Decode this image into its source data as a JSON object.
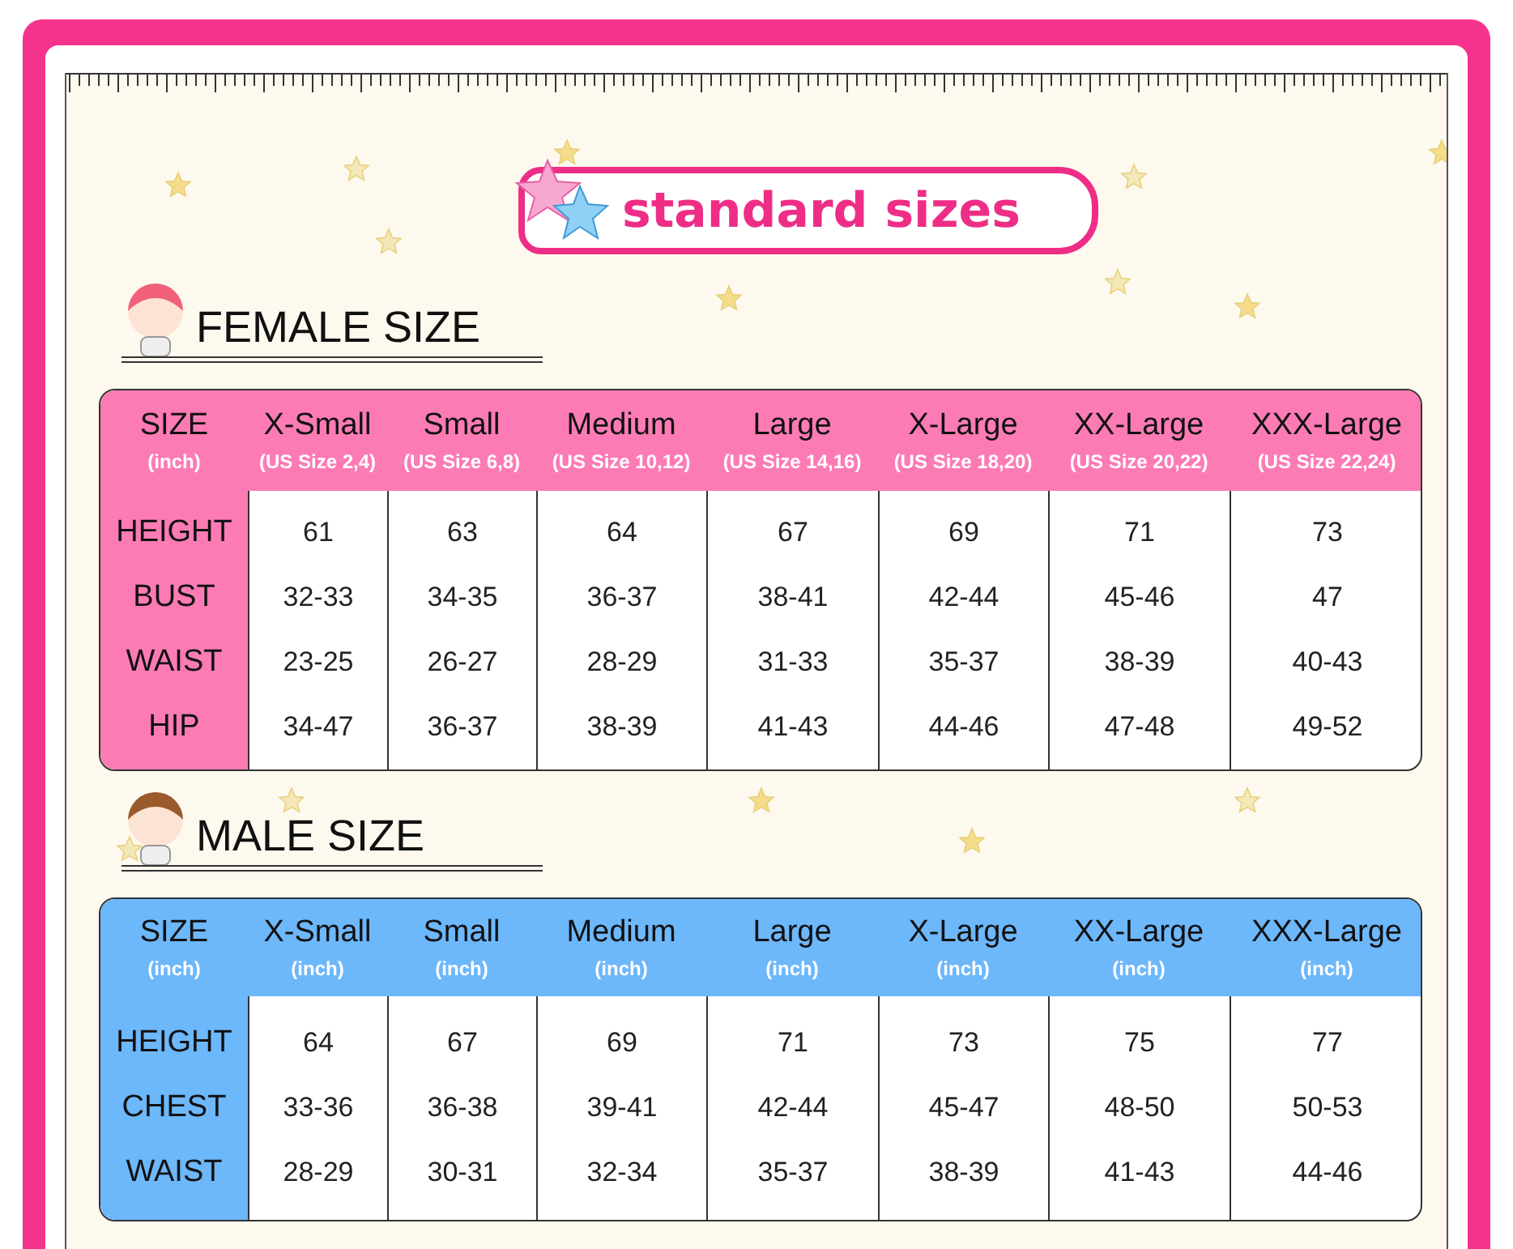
{
  "title": "standard sizes",
  "sections": [
    {
      "kind": "female",
      "heading": "FEMALE SIZE",
      "corner": {
        "label": "SIZE",
        "sub": "(inch)"
      },
      "columns": [
        {
          "label": "X-Small",
          "sub": "(US Size 2,4)"
        },
        {
          "label": "Small",
          "sub": "(US Size 6,8)"
        },
        {
          "label": "Medium",
          "sub": "(US Size 10,12)"
        },
        {
          "label": "Large",
          "sub": "(US Size 14,16)"
        },
        {
          "label": "X-Large",
          "sub": "(US Size 18,20)"
        },
        {
          "label": "XX-Large",
          "sub": "(US Size 20,22)"
        },
        {
          "label": "XXX-Large",
          "sub": "(US Size 22,24)"
        }
      ],
      "rows": [
        {
          "label": "HEIGHT",
          "cells": [
            "61",
            "63",
            "64",
            "67",
            "69",
            "71",
            "73"
          ]
        },
        {
          "label": "BUST",
          "cells": [
            "32-33",
            "34-35",
            "36-37",
            "38-41",
            "42-44",
            "45-46",
            "47"
          ]
        },
        {
          "label": "WAIST",
          "cells": [
            "23-25",
            "26-27",
            "28-29",
            "31-33",
            "35-37",
            "38-39",
            "40-43"
          ]
        },
        {
          "label": "HIP",
          "cells": [
            "34-47",
            "36-37",
            "38-39",
            "41-43",
            "44-46",
            "47-48",
            "49-52"
          ]
        }
      ]
    },
    {
      "kind": "male",
      "heading": "MALE SIZE",
      "corner": {
        "label": "SIZE",
        "sub": "(inch)"
      },
      "columns": [
        {
          "label": "X-Small",
          "sub": "(inch)"
        },
        {
          "label": "Small",
          "sub": "(inch)"
        },
        {
          "label": "Medium",
          "sub": "(inch)"
        },
        {
          "label": "Large",
          "sub": "(inch)"
        },
        {
          "label": "X-Large",
          "sub": "(inch)"
        },
        {
          "label": "XX-Large",
          "sub": "(inch)"
        },
        {
          "label": "XXX-Large",
          "sub": "(inch)"
        }
      ],
      "rows": [
        {
          "label": "HEIGHT",
          "cells": [
            "64",
            "67",
            "69",
            "71",
            "73",
            "75",
            "77"
          ]
        },
        {
          "label": "CHEST",
          "cells": [
            "33-36",
            "36-38",
            "39-41",
            "42-44",
            "45-47",
            "48-50",
            "50-53"
          ]
        },
        {
          "label": "WAIST",
          "cells": [
            "28-29",
            "30-31",
            "32-34",
            "35-37",
            "38-39",
            "41-43",
            "44-46"
          ]
        }
      ]
    }
  ]
}
